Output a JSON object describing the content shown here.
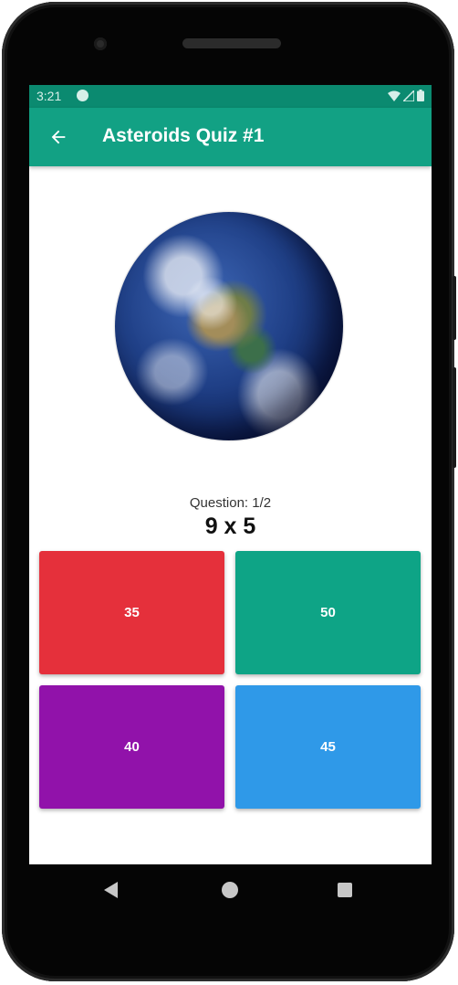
{
  "status_bar": {
    "time": "3:21"
  },
  "app_bar": {
    "title": "Asteroids Quiz #1",
    "back_icon": "arrow-back-icon"
  },
  "quiz": {
    "question_label": "Question: 1/2",
    "question_text": "9 x 5",
    "answers": [
      {
        "label": "35",
        "color": "#e5303b"
      },
      {
        "label": "50",
        "color": "#0ea486"
      },
      {
        "label": "40",
        "color": "#9112aa"
      },
      {
        "label": "45",
        "color": "#2f99e8"
      }
    ]
  },
  "nav_bar": {
    "icons": [
      "nav-back-icon",
      "nav-home-icon",
      "nav-recents-icon"
    ]
  },
  "colors": {
    "primary": "#12a184",
    "primary_dark": "#0b8a70"
  }
}
